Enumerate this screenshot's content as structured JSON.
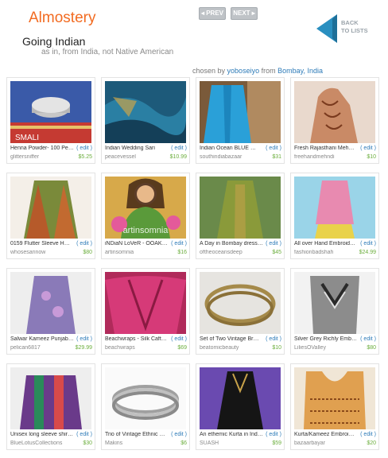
{
  "header": {
    "logo": "Almostery",
    "prev_label": "◂ PREV",
    "next_label": "NEXT ▸",
    "back_label_1": "BACK",
    "back_label_2": "TO LISTS"
  },
  "list": {
    "title": "Going Indian",
    "subtitle": "as in, from India, not Native American",
    "chosen_prefix": "chosen by",
    "chosen_user": "yoboseiyo",
    "chosen_from": "from",
    "chosen_city": "Bombay, India"
  },
  "edit_label": "( edit )",
  "watermark": "artinsomnia",
  "items": [
    {
      "title": "Henna Powder- 100 Pe…",
      "shop": "glittersniffer",
      "price": "$5.25"
    },
    {
      "title": "Indian Wedding Sari",
      "shop": "peacevessel",
      "price": "$10.99"
    },
    {
      "title": "Indian Ocean BLUE …",
      "shop": "southindiabazaar",
      "price": "$31"
    },
    {
      "title": "Fresh Rajasthani Meh…",
      "shop": "freehandmehndi",
      "price": "$10"
    },
    {
      "title": "0159 Flutter Sleeve H…",
      "shop": "whosesarinow",
      "price": "$80"
    },
    {
      "title": "iNDiaN LoVeR - OOAK…",
      "shop": "artinsomnia",
      "price": "$16"
    },
    {
      "title": "A Day in Bombay dress-…",
      "shop": "oftheoceansdeep",
      "price": "$45"
    },
    {
      "title": "All over Hand Embroid…",
      "shop": "fashionbadshah",
      "price": "$24.99"
    },
    {
      "title": "Salwar Kameez Punjabi…",
      "shop": "pelican6817",
      "price": "$29.99"
    },
    {
      "title": "Beachwraps - Silk Caft…",
      "shop": "beachwraps",
      "price": "$69"
    },
    {
      "title": "Set of Two Vintage Br…",
      "shop": "beatomicbeauty",
      "price": "$10"
    },
    {
      "title": "Silver Grey Richly Embr…",
      "shop": "LiliesOValley",
      "price": "$80"
    },
    {
      "title": "Unisex long sleeve shirt…",
      "shop": "BlueLotusCollections",
      "price": "$30"
    },
    {
      "title": "Trio of Vintage Ethnic …",
      "shop": "Makins",
      "price": "$6"
    },
    {
      "title": "An ethemic Kurta in Ind…",
      "shop": "SUASH",
      "price": "$59"
    },
    {
      "title": "Kurta/Kameez Embroi…",
      "shop": "bazaarbayar",
      "price": "$20"
    }
  ],
  "colors": {
    "logo": "#f26b21",
    "link": "#2d7bb8",
    "price": "#6cae3e",
    "back_arrow": "#2a8fc0"
  }
}
